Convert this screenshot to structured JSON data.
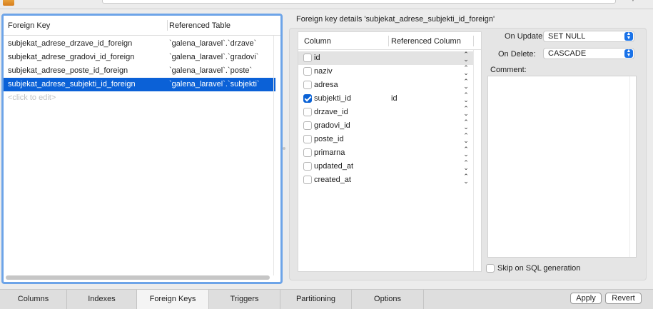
{
  "fk_table": {
    "headers": [
      "Foreign Key",
      "Referenced Table"
    ],
    "rows": [
      {
        "key": "subjekat_adrese_drzave_id_foreign",
        "table": "`galena_laravel`.`drzave`"
      },
      {
        "key": "subjekat_adrese_gradovi_id_foreign",
        "table": "`galena_laravel`.`gradovi`"
      },
      {
        "key": "subjekat_adrese_poste_id_foreign",
        "table": "`galena_laravel`.`poste`"
      },
      {
        "key": "subjekat_adrese_subjekti_id_foreign",
        "table": "`galena_laravel`.`subjekti`"
      }
    ],
    "hint": "<click to edit>"
  },
  "details": {
    "title": "Foreign key details 'subjekat_adrese_subjekti_id_foreign'",
    "columns_headers": [
      "Column",
      "Referenced Column"
    ],
    "columns": [
      {
        "name": "id",
        "checked": false,
        "ref": ""
      },
      {
        "name": "naziv",
        "checked": false,
        "ref": ""
      },
      {
        "name": "adresa",
        "checked": false,
        "ref": ""
      },
      {
        "name": "subjekti_id",
        "checked": true,
        "ref": "id"
      },
      {
        "name": "drzave_id",
        "checked": false,
        "ref": ""
      },
      {
        "name": "gradovi_id",
        "checked": false,
        "ref": ""
      },
      {
        "name": "poste_id",
        "checked": false,
        "ref": ""
      },
      {
        "name": "primarna",
        "checked": false,
        "ref": ""
      },
      {
        "name": "updated_at",
        "checked": false,
        "ref": ""
      },
      {
        "name": "created_at",
        "checked": false,
        "ref": ""
      }
    ],
    "on_update_label": "On Update:",
    "on_update_value": "SET NULL",
    "on_delete_label": "On Delete:",
    "on_delete_value": "CASCADE",
    "comment_label": "Comment:",
    "skip_label": "Skip on SQL generation"
  },
  "tabs": [
    "Columns",
    "Indexes",
    "Foreign Keys",
    "Triggers",
    "Partitioning",
    "Options"
  ],
  "active_tab": "Foreign Keys",
  "buttons": {
    "apply": "Apply",
    "revert": "Revert"
  },
  "colors": {
    "selection": "#0b61d7",
    "focus_ring": "#6da4e8",
    "checkbox_on": "#0a62d6"
  }
}
